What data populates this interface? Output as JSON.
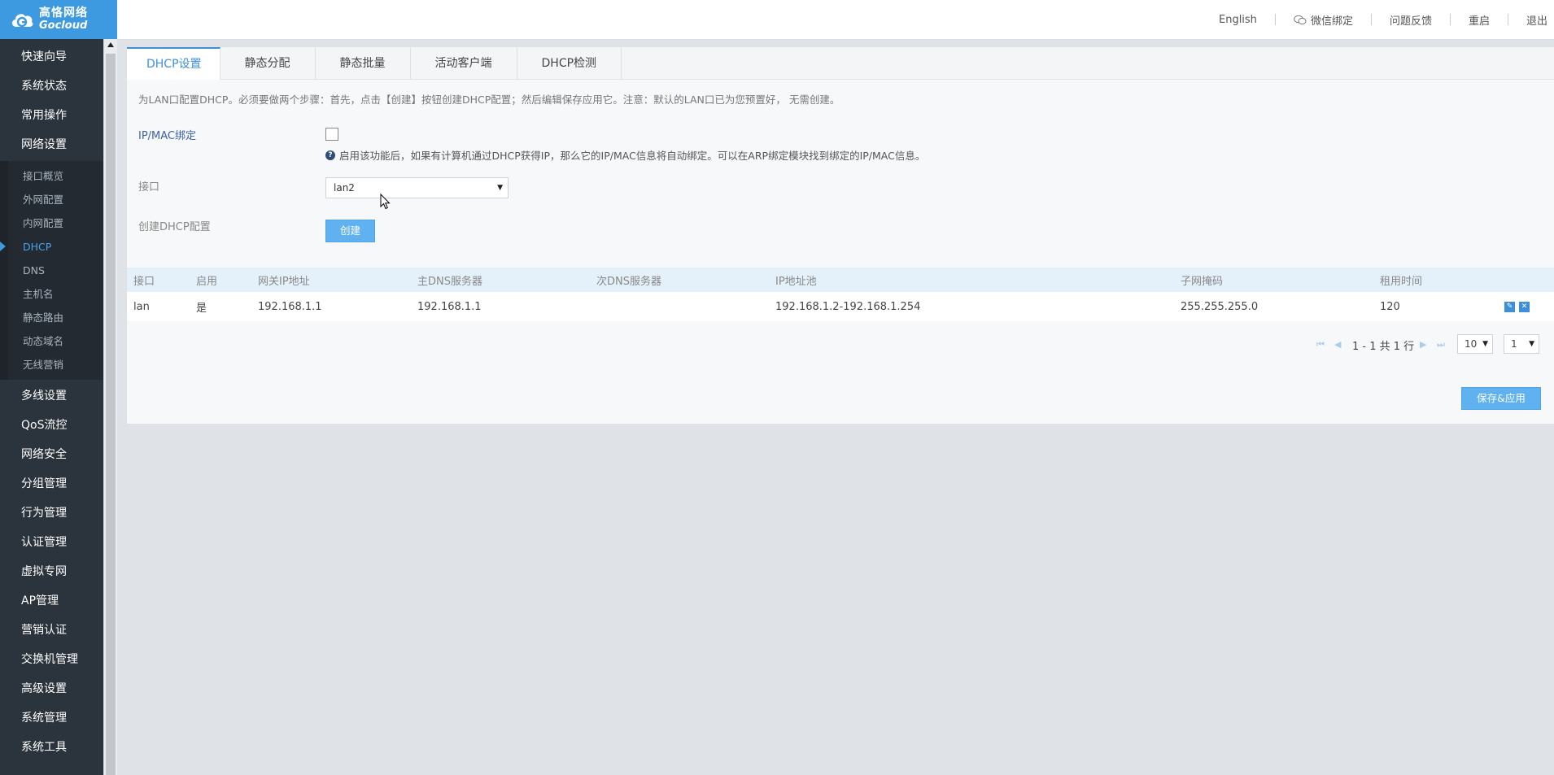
{
  "brand": {
    "name_cn": "高恪网络",
    "name_en": "Gocloud"
  },
  "topnav": {
    "english": "English",
    "wechat": "微信绑定",
    "feedback": "问题反馈",
    "reboot": "重启",
    "logout": "退出"
  },
  "sidebar": {
    "items_top": [
      {
        "label": "快速向导"
      },
      {
        "label": "系统状态"
      },
      {
        "label": "常用操作"
      },
      {
        "label": "网络设置"
      }
    ],
    "sub_items": [
      {
        "label": "接口概览"
      },
      {
        "label": "外网配置"
      },
      {
        "label": "内网配置"
      },
      {
        "label": "DHCP",
        "active": true
      },
      {
        "label": "DNS"
      },
      {
        "label": "主机名"
      },
      {
        "label": "静态路由"
      },
      {
        "label": "动态域名"
      },
      {
        "label": "无线营销"
      }
    ],
    "items_bottom": [
      {
        "label": "多线设置"
      },
      {
        "label": "QoS流控"
      },
      {
        "label": "网络安全"
      },
      {
        "label": "分组管理"
      },
      {
        "label": "行为管理"
      },
      {
        "label": "认证管理"
      },
      {
        "label": "虚拟专网"
      },
      {
        "label": "AP管理"
      },
      {
        "label": "营销认证"
      },
      {
        "label": "交换机管理"
      },
      {
        "label": "高级设置"
      },
      {
        "label": "系统管理"
      },
      {
        "label": "系统工具"
      }
    ]
  },
  "tabs": [
    {
      "label": "DHCP设置",
      "active": true
    },
    {
      "label": "静态分配"
    },
    {
      "label": "静态批量"
    },
    {
      "label": "活动客户端"
    },
    {
      "label": "DHCP检测"
    }
  ],
  "form": {
    "description": "为LAN口配置DHCP。必须要做两个步骤：首先，点击【创建】按钮创建DHCP配置；然后编辑保存应用它。注意：默认的LAN口已为您预置好， 无需创建。",
    "ipmac_label": "IP/MAC绑定",
    "ipmac_checked": false,
    "ipmac_hint": "启用该功能后，如果有计算机通过DHCP获得IP，那么它的IP/MAC信息将自动绑定。可以在ARP绑定模块找到绑定的IP/MAC信息。",
    "interface_label": "接口",
    "interface_value": "lan2",
    "create_label": "创建DHCP配置",
    "create_button": "创建"
  },
  "table": {
    "headers": {
      "iface": "接口",
      "enabled": "启用",
      "gateway": "网关IP地址",
      "dns1": "主DNS服务器",
      "dns2": "次DNS服务器",
      "pool": "IP地址池",
      "mask": "子网掩码",
      "lease": "租用时间"
    },
    "rows": [
      {
        "iface": "lan",
        "enabled": "是",
        "gateway": "192.168.1.1",
        "dns1": "192.168.1.1",
        "dns2": "",
        "pool": "192.168.1.2-192.168.1.254",
        "mask": "255.255.255.0",
        "lease": "120"
      }
    ]
  },
  "pager": {
    "summary": "1 - 1 共 1 行",
    "page_size": "10",
    "page": "1"
  },
  "save_button": "保存&应用",
  "colors": {
    "accent": "#3d9ae0",
    "sidebar_bg": "#2b333c",
    "button": "#5fb2ef"
  }
}
